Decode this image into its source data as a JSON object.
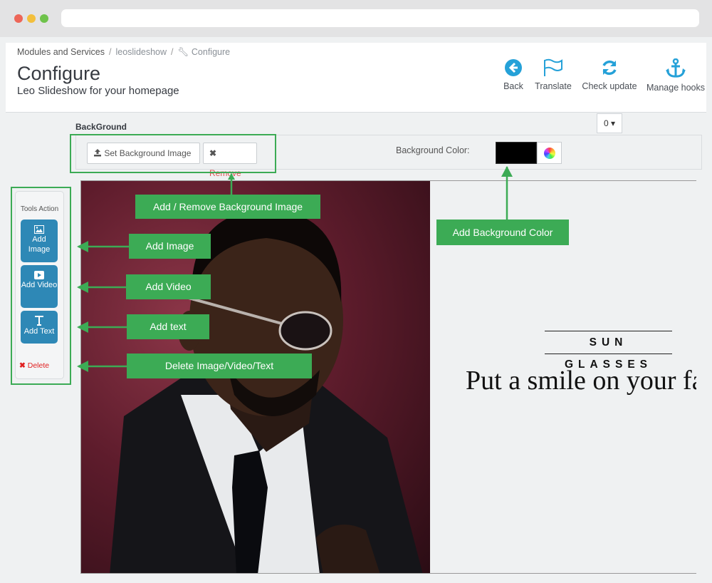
{
  "breadcrumb": {
    "item1": "Modules and Services",
    "item2": "leoslideshow",
    "item3": "Configure"
  },
  "page": {
    "title": "Configure",
    "subtitle": "Leo Slideshow for your homepage"
  },
  "toolbar": {
    "back": "Back",
    "translate": "Translate",
    "check_update": "Check update",
    "manage_hooks": "Manage hooks"
  },
  "background": {
    "section_label": "BackGround",
    "dropdown_value": "0",
    "set_image_label": "Set Background Image",
    "remove_label": "Remove",
    "color_label": "Background Color:",
    "color_value": "#000000"
  },
  "tools": {
    "title": "Tools Action",
    "add_image": "Add Image",
    "add_video": "Add Video",
    "add_text": "Add Text",
    "delete": "Delete"
  },
  "slide": {
    "heading": "SUN GLASSES",
    "tagline": "Put a smile on your face"
  },
  "callouts": {
    "bg_image": "Add / Remove Background Image",
    "bg_color": "Add Background Color",
    "add_image": "Add Image",
    "add_video": "Add Video",
    "add_text": "Add text",
    "delete": "Delete Image/Video/Text"
  },
  "colors": {
    "accent_green": "#3cab55",
    "tool_blue": "#2e88b6",
    "toolbar_icon": "#25a1d8"
  }
}
